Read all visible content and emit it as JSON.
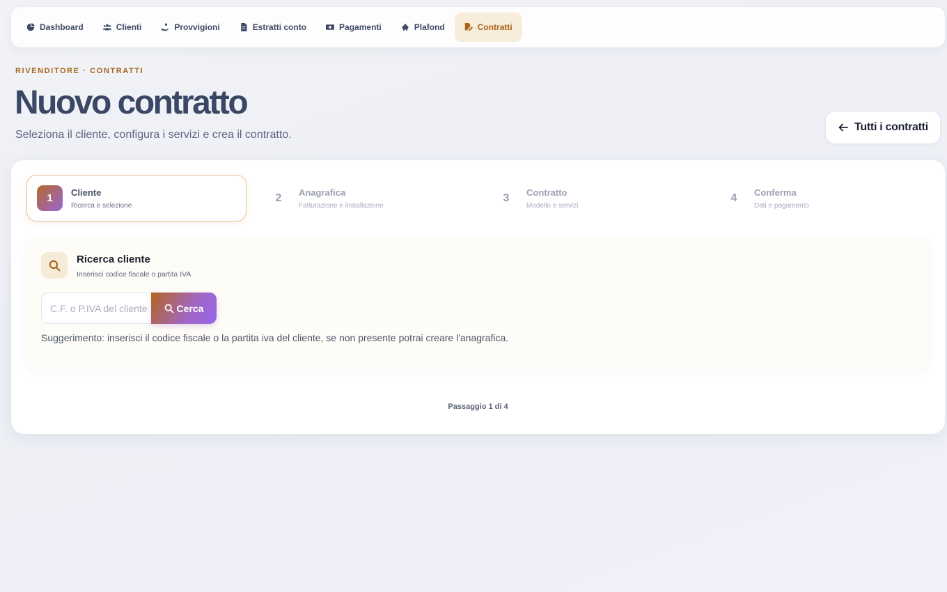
{
  "nav": {
    "items": [
      {
        "label": "Dashboard",
        "icon": "chart-pie-icon"
      },
      {
        "label": "Clienti",
        "icon": "users-icon"
      },
      {
        "label": "Provvigioni",
        "icon": "hand-coin-icon"
      },
      {
        "label": "Estratti conto",
        "icon": "file-invoice-icon"
      },
      {
        "label": "Pagamenti",
        "icon": "money-bill-icon"
      },
      {
        "label": "Plafond",
        "icon": "piggy-bank-icon"
      },
      {
        "label": "Contratti",
        "icon": "file-signature-icon",
        "active": true
      }
    ]
  },
  "header": {
    "eyebrow": "RIVENDITORE · CONTRATTI",
    "title": "Nuovo contratto",
    "subtitle": "Seleziona il cliente, configura i servizi e crea il contratto.",
    "back_label": "Tutti i contratti"
  },
  "steps": [
    {
      "num": "1",
      "title": "Cliente",
      "sub": "Ricerca e selezione",
      "active": true
    },
    {
      "num": "2",
      "title": "Anagrafica",
      "sub": "Fatturazione e installazione"
    },
    {
      "num": "3",
      "title": "Contratto",
      "sub": "Modello e servizi"
    },
    {
      "num": "4",
      "title": "Conferma",
      "sub": "Dati e pagamento"
    }
  ],
  "search": {
    "title": "Ricerca cliente",
    "subtitle": "Inserisci codice fiscale o partita IVA",
    "placeholder": "C.F. o P.IVA del cliente",
    "value": "",
    "button_label": "Cerca",
    "hint": "Suggerimento: inserisci il codice fiscale o la partita iva del cliente, se non presente potrai creare l'anagrafica."
  },
  "progress": {
    "label": "Passaggio 1 di 4"
  },
  "colors": {
    "accent": "#a8661a",
    "accent_bg": "#f8ecdb",
    "title": "#3a4866"
  }
}
